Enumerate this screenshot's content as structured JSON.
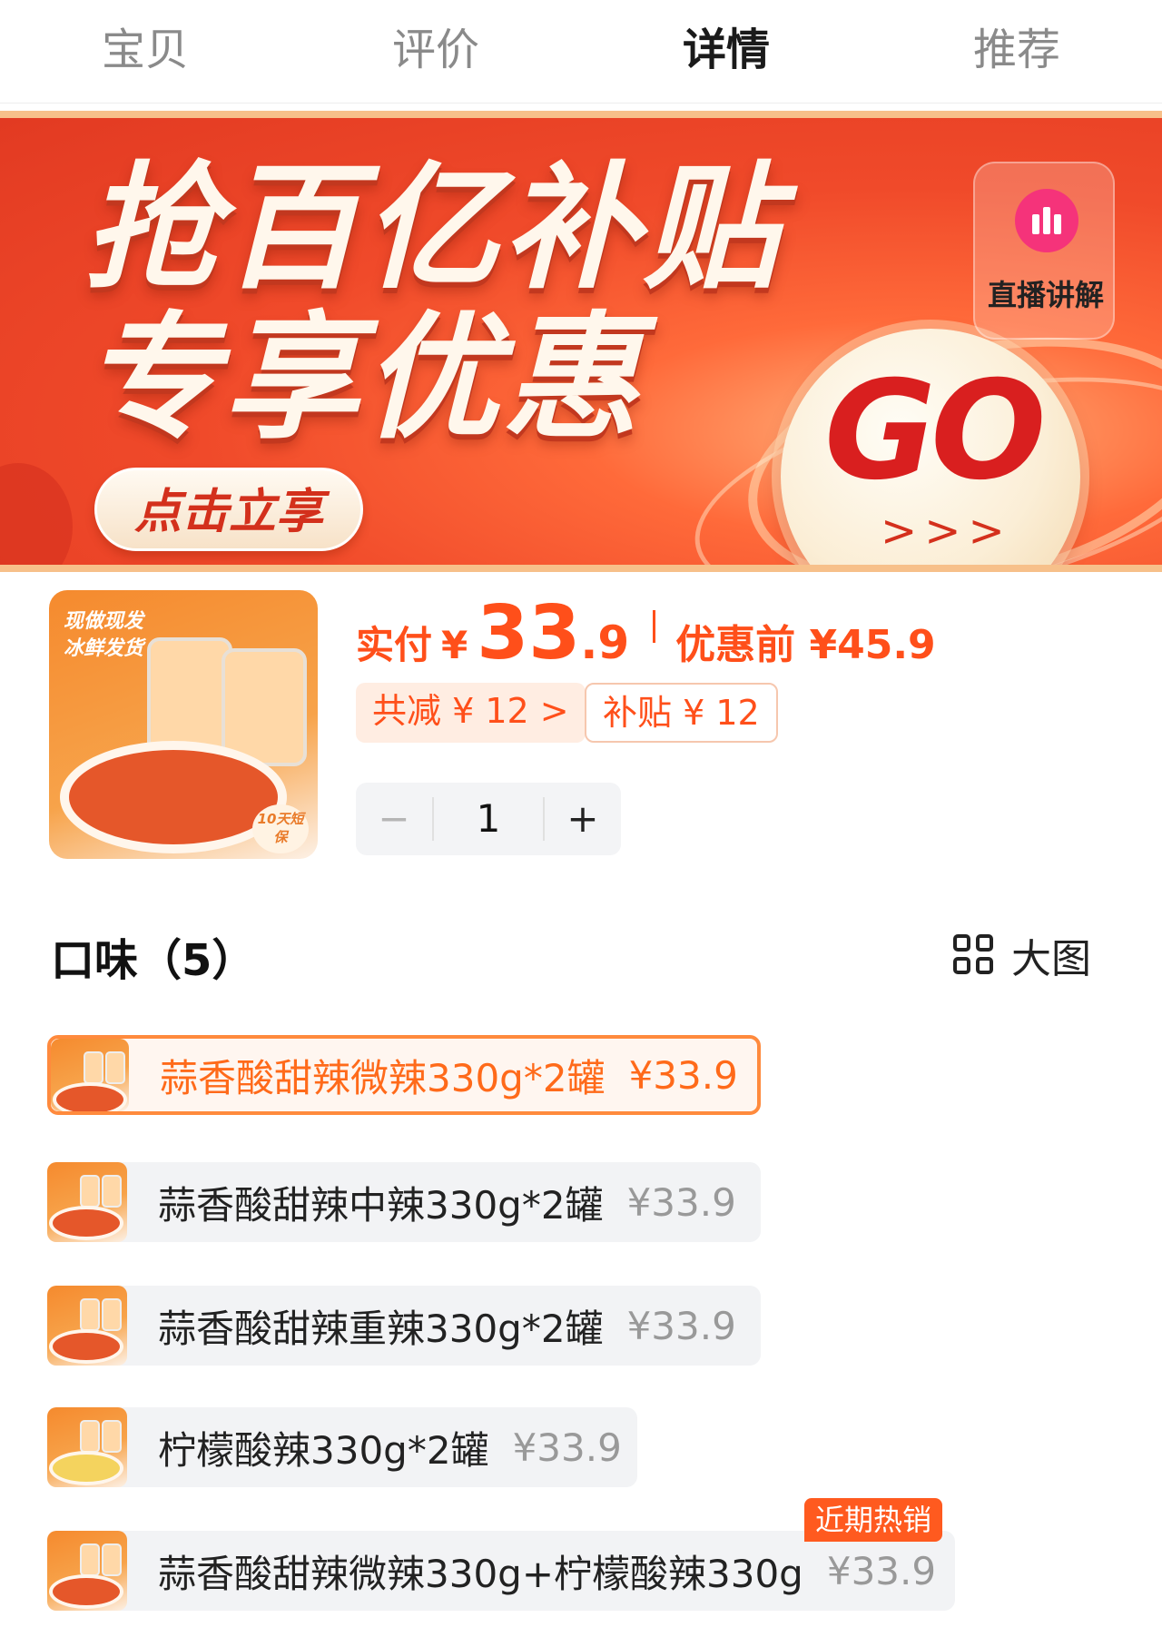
{
  "tabs": [
    {
      "label": "宝贝",
      "active": false
    },
    {
      "label": "评价",
      "active": false
    },
    {
      "label": "详情",
      "active": true
    },
    {
      "label": "推荐",
      "active": false
    }
  ],
  "banner": {
    "title_line1": "抢百亿补贴",
    "title_line2": "专享优惠",
    "cta": "点击立享",
    "go_text": "GO",
    "go_arrows": ">>>",
    "live_label": "直播讲解"
  },
  "product": {
    "thumb_text_line1": "现做现发",
    "thumb_text_line2": "冰鲜发货",
    "thumb_badge": "10天短保",
    "price_label": "实付",
    "currency": "¥",
    "price_int": "33",
    "price_dec": ".9",
    "orig_price": "优惠前 ¥45.9",
    "chip_total": "共减 ¥ 12 >",
    "chip_subsidy": "补贴 ¥ 12",
    "quantity": "1",
    "minus": "−",
    "plus": "+"
  },
  "flavor": {
    "title": "口味（5）",
    "bigview_label": "大图",
    "options": [
      {
        "name": "蒜香酸甜辣微辣330g*2罐",
        "price": "¥33.9",
        "selected": true
      },
      {
        "name": "蒜香酸甜辣中辣330g*2罐",
        "price": "¥33.9",
        "selected": false
      },
      {
        "name": "蒜香酸甜辣重辣330g*2罐",
        "price": "¥33.9",
        "selected": false
      },
      {
        "name": "柠檬酸辣330g*2罐",
        "price": "¥33.9",
        "selected": false
      },
      {
        "name": "蒜香酸甜辣微辣330g+柠檬酸辣330g",
        "price": "¥33.9",
        "selected": false
      }
    ],
    "hot_badge": "近期热销"
  },
  "colors": {
    "accent": "#ff4f1a",
    "selected_border": "#ff8a3d",
    "banner_red": "#e23a22",
    "option_bg": "#f2f3f5"
  },
  "icons": {
    "live": "live-bars-icon",
    "grid": "grid-icon"
  }
}
